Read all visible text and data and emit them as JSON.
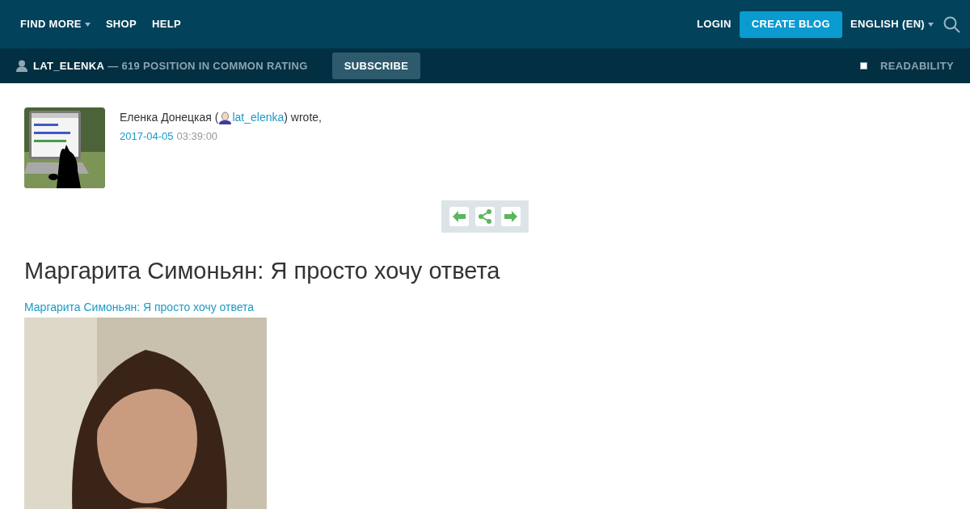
{
  "top_nav": {
    "left": [
      {
        "label": "FIND MORE",
        "dropdown": true
      },
      {
        "label": "SHOP",
        "dropdown": false
      },
      {
        "label": "HELP",
        "dropdown": false
      }
    ],
    "login": "LOGIN",
    "create_blog": "CREATE BLOG",
    "language": "ENGLISH (EN)"
  },
  "journal_bar": {
    "username": "LAT_ELENKA",
    "rating": "— 619 POSITION IN COMMON RATING",
    "subscribe": "SUBSCRIBE",
    "readability": {
      "label": "READABILITY",
      "checked": false
    }
  },
  "post": {
    "author_name": "Еленка Донецкая (",
    "author_link": "lat_elenka",
    "author_suffix": ") wrote,",
    "date": "2017-04-05",
    "time": "03:39:00",
    "title": "Маргарита Симоньян: Я просто хочу ответа",
    "source_link": "Маргарита Симоньян: Я просто хочу ответа"
  }
}
